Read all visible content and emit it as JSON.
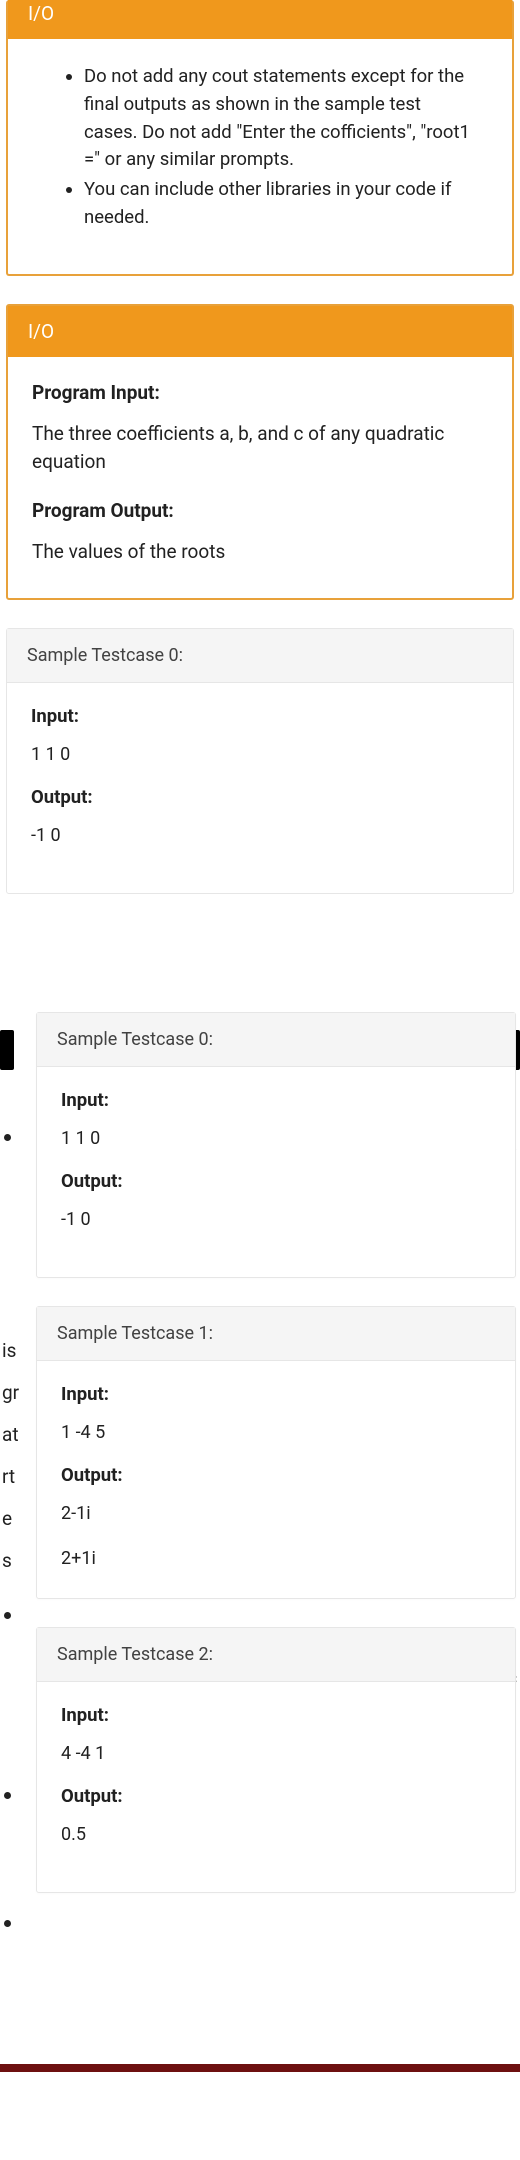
{
  "box1": {
    "header": "I/O",
    "bullets": [
      "Do not add any cout statements except for the final outputs as shown in the sample test cases. Do not add \"Enter the cofficients\", \"root1 =\" or any similar prompts.",
      "You can include other libraries in your code if needed."
    ]
  },
  "box2": {
    "header": "I/O",
    "program_input_label": "Program Input:",
    "program_input_text": "The three coefficients a, b, and c of any quadratic equation",
    "program_output_label": "Program Output:",
    "program_output_text": "The values of the roots"
  },
  "tc_main": {
    "title": "Sample Testcase 0:",
    "input_label": "Input:",
    "input_value": "1 1 0",
    "output_label": "Output:",
    "output_value": "-1 0"
  },
  "overlay": {
    "tc0": {
      "title": "Sample Testcase 0:",
      "input_label": "Input:",
      "input_value": "1 1 0",
      "output_label": "Output:",
      "output_value": "-1 0"
    },
    "tc1": {
      "title": "Sample Testcase 1:",
      "input_label": "Input:",
      "input_value": "1 -4 5",
      "output_label": "Output:",
      "output_line1": "2-1i",
      "output_line2": "2+1i"
    },
    "tc2": {
      "title": "Sample Testcase 2:",
      "input_label": "Input:",
      "input_value": "4 -4 1",
      "output_label": "Output:",
      "output_value": "0.5"
    }
  },
  "side_letters": [
    "is",
    "gr",
    "at",
    "rt",
    "e",
    "s"
  ]
}
